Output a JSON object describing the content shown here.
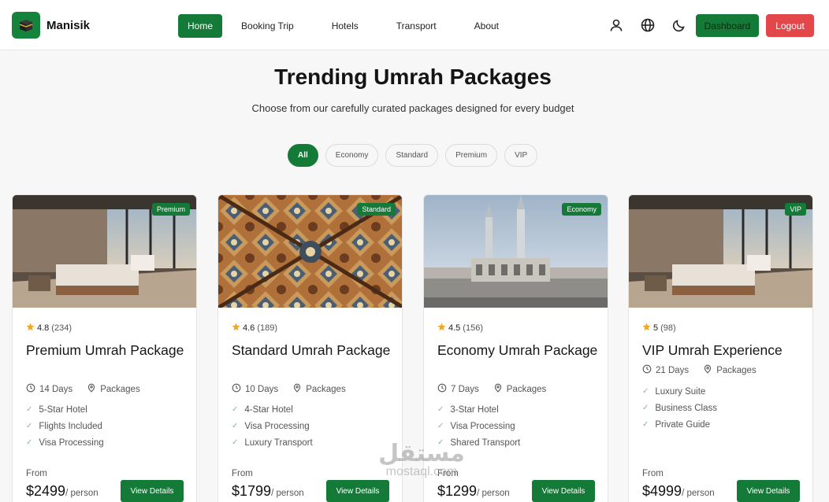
{
  "brand": {
    "name": "Manisik"
  },
  "nav": {
    "links": [
      "Home",
      "Booking Trip",
      "Hotels",
      "Transport",
      "About"
    ],
    "dashboard": "Dashboard",
    "logout": "Logout"
  },
  "colors": {
    "primary": "#137b37",
    "danger": "#e4474a",
    "star": "#f0a824"
  },
  "hero": {
    "title": "Trending Umrah Packages",
    "subtitle": "Choose from our carefully curated packages designed for every budget"
  },
  "filters": [
    "All",
    "Economy",
    "Standard",
    "Premium",
    "VIP"
  ],
  "cards": [
    {
      "badge": "Premium",
      "rating": "4.8",
      "reviews": "(234)",
      "title": "Premium Umrah Package",
      "days": "14 Days",
      "category": "Packages",
      "features": [
        "5-Star Hotel",
        "Flights Included",
        "Visa Processing"
      ],
      "from": "From",
      "price": "$2499",
      "per": "/ person",
      "button": "View Details"
    },
    {
      "badge": "Standard",
      "rating": "4.6",
      "reviews": "(189)",
      "title": "Standard Umrah Package",
      "days": "10 Days",
      "category": "Packages",
      "features": [
        "4-Star Hotel",
        "Visa Processing",
        "Luxury Transport"
      ],
      "from": "From",
      "price": "$1799",
      "per": "/ person",
      "button": "View Details"
    },
    {
      "badge": "Economy",
      "rating": "4.5",
      "reviews": "(156)",
      "title": "Economy Umrah Package",
      "days": "7 Days",
      "category": "Packages",
      "features": [
        "3-Star Hotel",
        "Visa Processing",
        "Shared Transport"
      ],
      "from": "From",
      "price": "$1299",
      "per": "/ person",
      "button": "View Details"
    },
    {
      "badge": "VIP",
      "rating": "5",
      "reviews": "(98)",
      "title": "VIP Umrah Experience",
      "days": "21 Days",
      "category": "Packages",
      "features": [
        "Luxury Suite",
        "Business Class",
        "Private Guide"
      ],
      "from": "From",
      "price": "$4999",
      "per": "/ person",
      "button": "View Details"
    }
  ],
  "watermark": {
    "arabic": "مستقل",
    "latin": "mostaql.com"
  }
}
